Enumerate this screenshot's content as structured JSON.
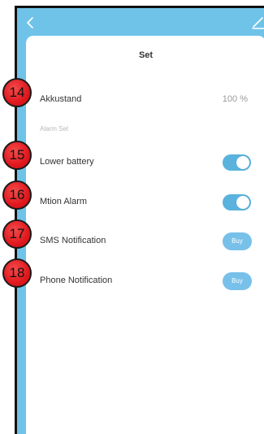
{
  "header": {
    "title": "Set"
  },
  "colors": {
    "frame": "#6fc3e8",
    "toggle_on": "#5ab2dd",
    "buy_button": "#77c0ea",
    "badge": "#e0181e"
  },
  "rows": {
    "battery": {
      "label": "Akkustand",
      "value": "100 %"
    },
    "section": "Alarm Set",
    "lower_battery": {
      "label": "Lower battery",
      "state": "on"
    },
    "motion_alarm": {
      "label": "Mtion Alarm",
      "state": "on"
    },
    "sms_notification": {
      "label": "SMS Notification",
      "button": "Buy"
    },
    "phone_notification": {
      "label": "Phone Notification",
      "button": "Buy"
    }
  },
  "badges": {
    "b14": "14",
    "b15": "15",
    "b16": "16",
    "b17": "17",
    "b18": "18"
  }
}
